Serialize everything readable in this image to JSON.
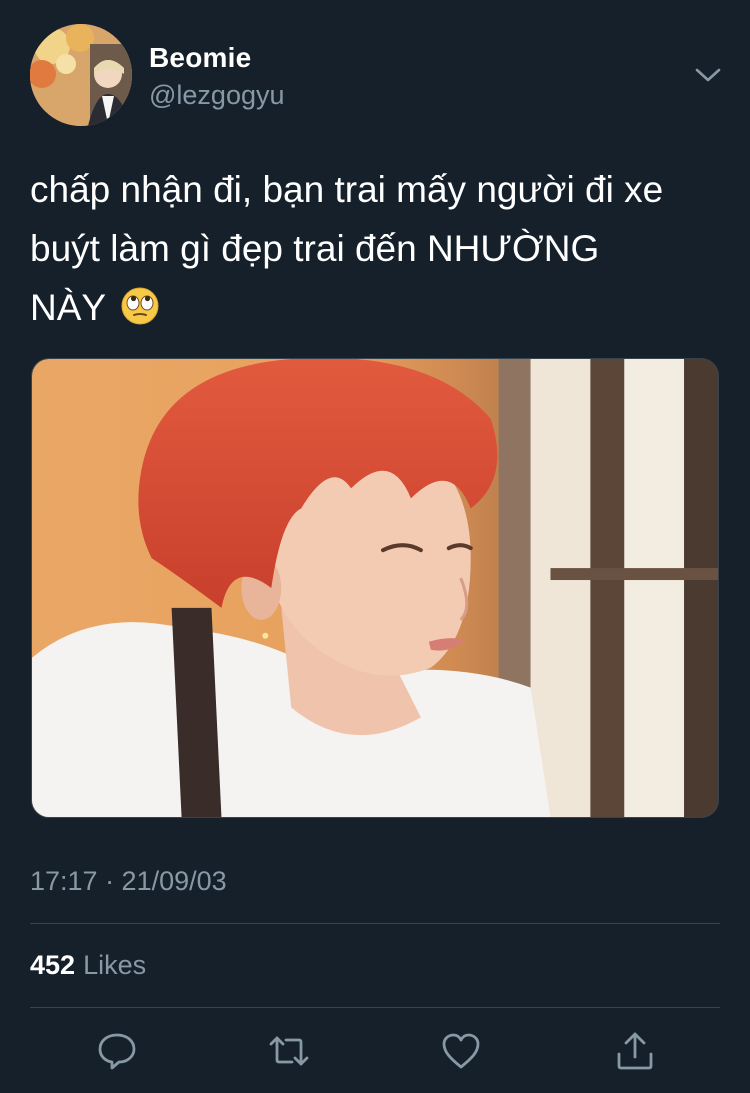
{
  "user": {
    "display_name": "Beomie",
    "handle": "@lezgogyu"
  },
  "tweet": {
    "text_line1": "chấp nhận đi, bạn trai mấy người đi xe",
    "text_line2": "buýt làm gì đẹp trai đến NHƯỜNG",
    "text_line3": "NÀY",
    "emoji_icon": "face-with-rolling-eyes-icon",
    "timestamp": "17:17 · 21/09/03"
  },
  "stats": {
    "likes_count": "452",
    "likes_label": "Likes"
  },
  "actions": [
    {
      "icon": "reply-icon"
    },
    {
      "icon": "retweet-icon"
    },
    {
      "icon": "like-heart-icon"
    },
    {
      "icon": "share-icon"
    }
  ],
  "colors": {
    "background": "#15202b",
    "text_primary": "#ffffff",
    "text_secondary": "#8899a6",
    "divider": "#38444d"
  }
}
